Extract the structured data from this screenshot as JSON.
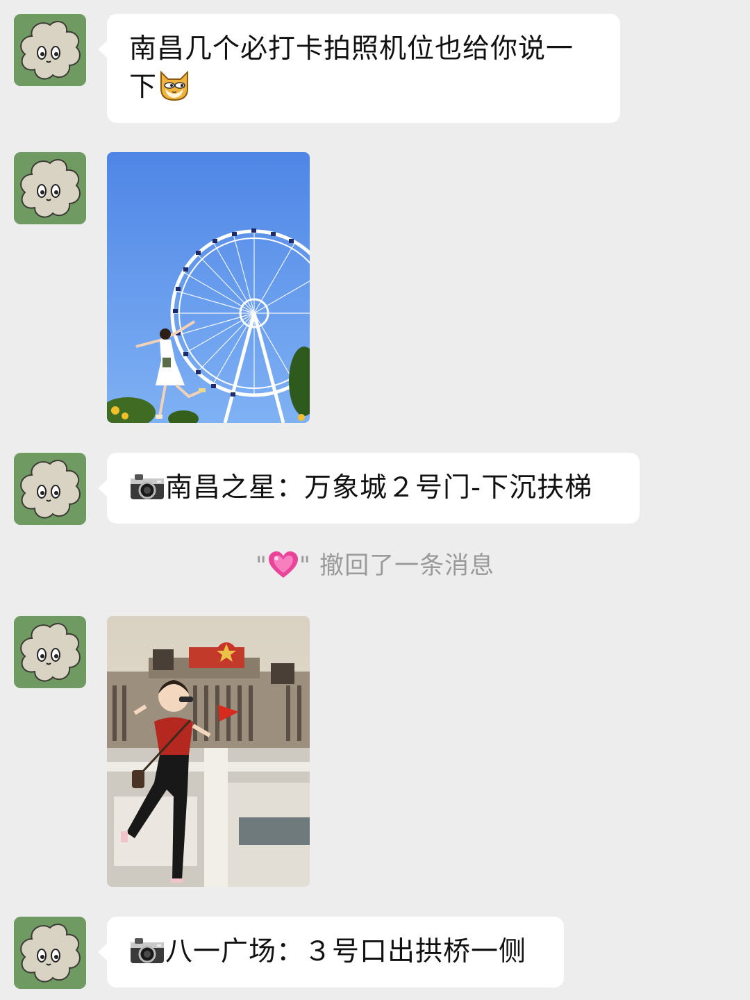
{
  "colors": {
    "background": "#ededed",
    "bubble": "#ffffff",
    "avatar_bg": "#6f9a62",
    "system_text": "#9a9a9a"
  },
  "messages": [
    {
      "type": "text",
      "text": "南昌几个必打卡拍照机位也给你说一下",
      "emoji": "doge-cat-emoji"
    },
    {
      "type": "image",
      "subject": "ferris-wheel-photo"
    },
    {
      "type": "text",
      "prefix_icon": "camera-emoji",
      "text": "南昌之星：万象城２号门-下沉扶梯"
    },
    {
      "type": "image",
      "subject": "bayi-square-photo"
    },
    {
      "type": "text",
      "prefix_icon": "camera-emoji",
      "text": "八一广场：３号口出拱桥一侧"
    }
  ],
  "system_notice": {
    "quote_open": "\"",
    "heart_icon": "pink-heart-emoji",
    "quote_close": "\"",
    "text": "撤回了一条消息"
  }
}
